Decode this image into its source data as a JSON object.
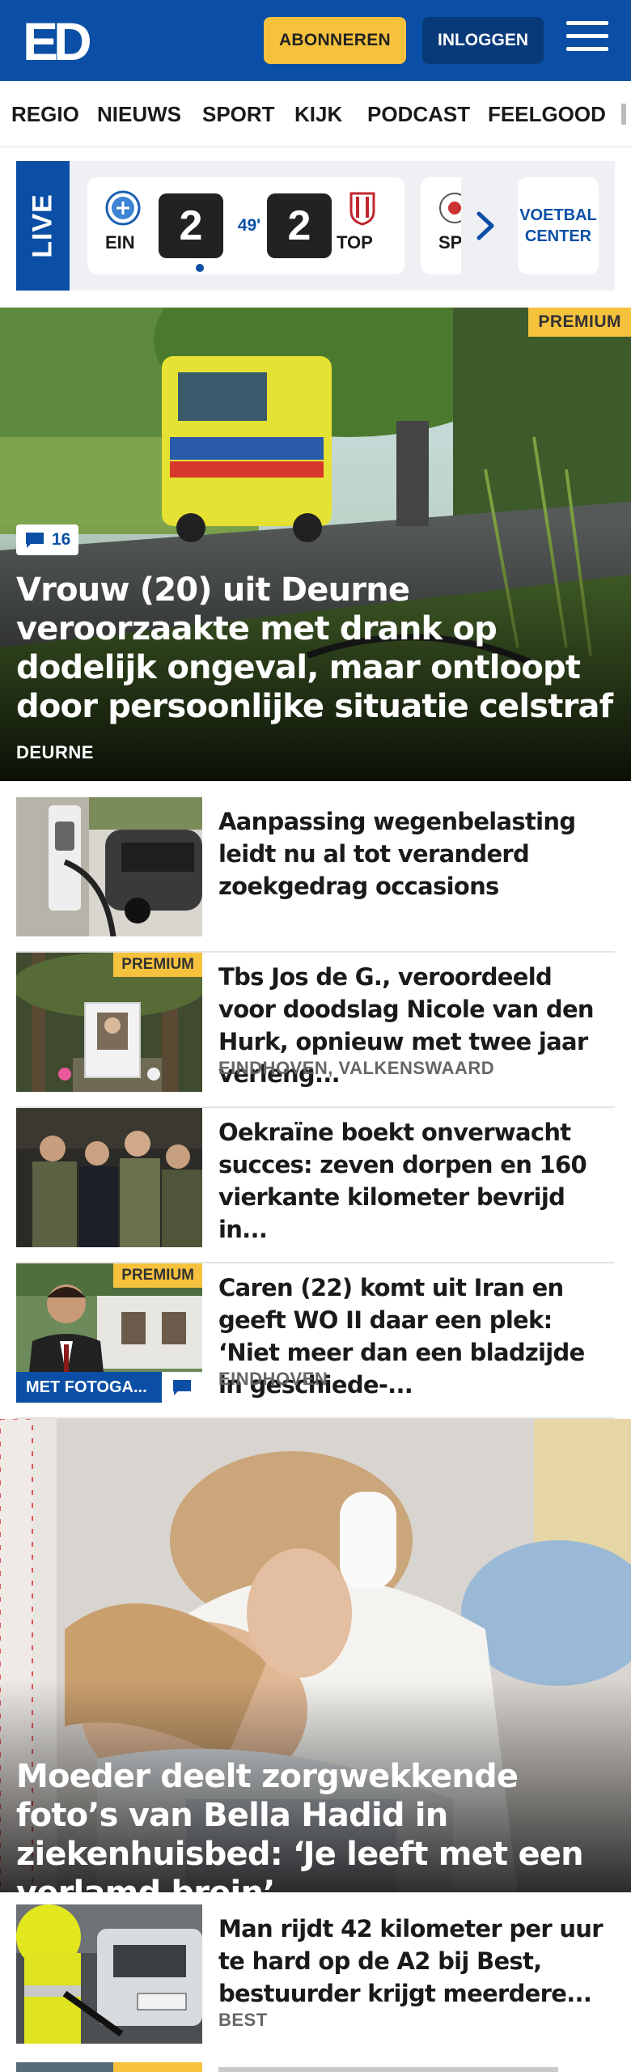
{
  "header": {
    "logo_text": "ED",
    "subscribe_label": "ABONNEREN",
    "login_label": "INLOGGEN"
  },
  "nav": {
    "items": [
      "REGIO",
      "NIEUWS",
      "SPORT",
      "KIJK",
      "PODCAST",
      "FEELGOOD"
    ]
  },
  "live": {
    "label": "LIVE",
    "match": {
      "home_code": "EIN",
      "away_code": "TOP",
      "home_score": "2",
      "away_score": "2",
      "minute": "49'"
    },
    "next_match_code": "SP",
    "voetbal_center_label": "VOETBAL CENTER"
  },
  "hero": {
    "premium_label": "PREMIUM",
    "comment_count": "16",
    "title": "Vrouw (20) uit Deurne veroorzaakte met drank op dodelijk ongeval, maar ontloopt door persoonlijke situatie celstraf",
    "location": "DEURNE"
  },
  "articles": [
    {
      "title": "Aanpassing wegenbelasting leidt nu al tot veranderd zoekgedrag occasions",
      "location": "",
      "premium": ""
    },
    {
      "title": "Tbs Jos de G., veroordeeld voor doodslag Nicole van den Hurk, opnieuw met twee jaar verleng...",
      "location": "EINDHOVEN, VALKENSWAARD",
      "premium": "PREMIUM"
    },
    {
      "title": "Oekraïne boekt onverwacht succes: zeven dorpen en 160 vierkante kilometer bevrijd in...",
      "location": "",
      "premium": ""
    },
    {
      "title": "Caren (22) komt uit Iran en geeft WO II daar een plek: ‘Niet meer dan een bladzijde in geschiede-...",
      "location": "EINDHOVEN",
      "premium": "PREMIUM",
      "tag": "MET FOTOGA..."
    }
  ],
  "hero2": {
    "title": "Moeder deelt zorgwekkende foto’s van Bella Hadid in ziekenhuisbed: ‘Je leeft met een verlamd brein’"
  },
  "article5": {
    "title": "Man rijdt 42 kilometer per uur te hard op de A2 bij Best, bestuurder krijgt meerdere...",
    "location": "BEST"
  },
  "colors": {
    "brand_blue": "#0a4fa5",
    "accent_yellow": "#f6c23e",
    "dark_blue": "#083a7a"
  }
}
